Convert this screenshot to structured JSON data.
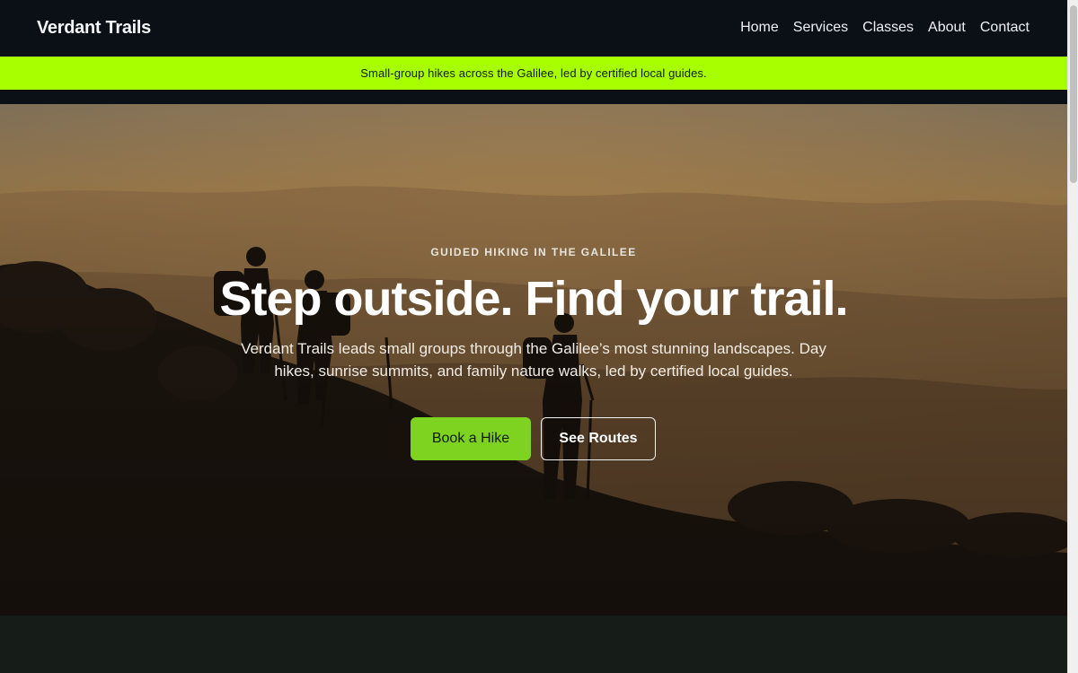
{
  "header": {
    "brand": "Verdant Trails",
    "nav": [
      "Home",
      "Services",
      "Classes",
      "About",
      "Contact"
    ]
  },
  "announcement": "Small-group hikes across the Galilee, led by certified local guides.",
  "hero": {
    "eyebrow": "GUIDED HIKING IN THE GALILEE",
    "headline": "Step outside. Find your trail.",
    "subtext": "Verdant Trails leads small groups through the Galilee’s most stunning landscapes. Day hikes, sunrise summits, and family nature walks, led by certified local guides.",
    "primary_button": "Book a Hike",
    "secondary_button": "See Routes"
  },
  "colors": {
    "accent_bar": "#a8ff00",
    "primary_button": "#7ed321",
    "header_bg": "#0b0f16"
  },
  "icons": {
    "hero_image": "hikers-silhouette-image"
  }
}
